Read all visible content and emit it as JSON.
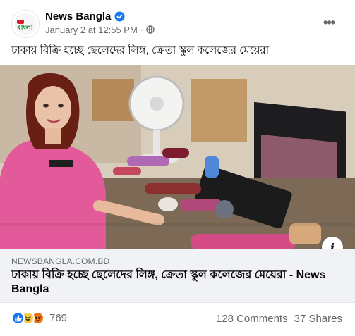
{
  "header": {
    "page_name": "News Bangla",
    "timestamp": "January 2 at 12:55 PM",
    "separator": "·",
    "avatar_text": "বাংলা",
    "icons": {
      "verified": "verified-badge-icon",
      "privacy": "globe-icon",
      "more": "more-horizontal-icon"
    }
  },
  "post": {
    "caption": "ঢাকায় বিক্রি হচ্ছে ছেলেদের লিঙ্গ, ক্রেতা স্কুল কলেজের মেয়েরা"
  },
  "link": {
    "domain": "NEWSBANGLA.COM.BD",
    "title": "ঢাকায় বিক্রি হচ্ছে ছেলেদের লিঙ্গ, ক্রেতা স্কুল কলেজের মেয়েরা - News Bangla",
    "info_icon": "i"
  },
  "footer": {
    "reactions": [
      "like",
      "haha",
      "angry"
    ],
    "reaction_count": "769",
    "comments": "128 Comments",
    "shares": "37 Shares"
  },
  "colors": {
    "brand_blue": "#1877f2",
    "secondary_text": "#65676b",
    "preview_bg": "#f0f2f5"
  }
}
